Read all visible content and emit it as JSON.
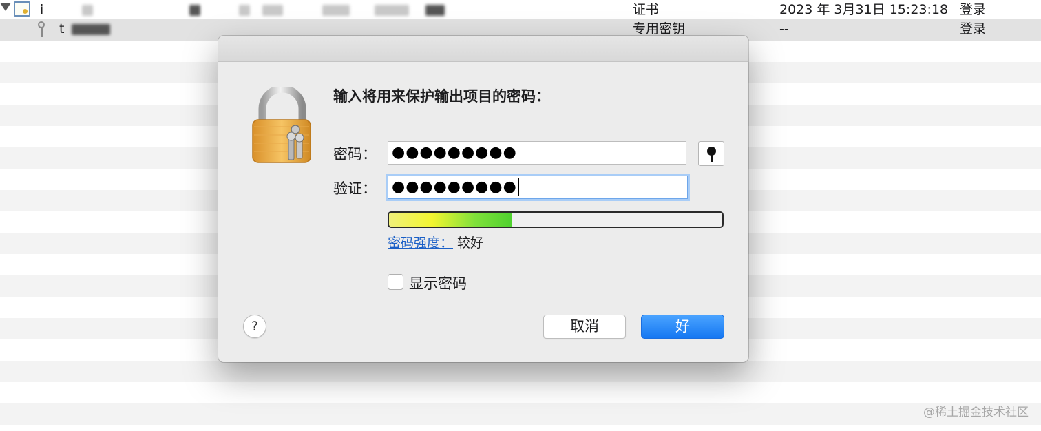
{
  "list": {
    "rows": [
      {
        "name": "i",
        "kind": "证书",
        "date": "2023 年 3月31日 15:23:18",
        "keychain": "登录"
      },
      {
        "name": "t",
        "kind": "专用密钥",
        "date": "--",
        "keychain": "登录"
      }
    ]
  },
  "dialog": {
    "prompt": "输入将用来保护输出项目的密码：",
    "password_label": "密码：",
    "verify_label": "验证：",
    "password_value": "●●●●●●●●●",
    "verify_value": "●●●●●●●●●",
    "strength_label": "密码强度：",
    "strength_value": "较好",
    "strength_fraction": 0.37,
    "show_password_label": "显示密码",
    "show_password_checked": false,
    "help_label": "?",
    "cancel_label": "取消",
    "ok_label": "好"
  },
  "colors": {
    "accent": "#1577f2",
    "link": "#1a5fc7",
    "focus_ring": "#a9cdf7"
  },
  "icons": [
    "disclosure-triangle-icon",
    "certificate-icon",
    "key-icon",
    "padlock-icon",
    "key-button-icon"
  ],
  "watermark": "@稀土掘金技术社区"
}
